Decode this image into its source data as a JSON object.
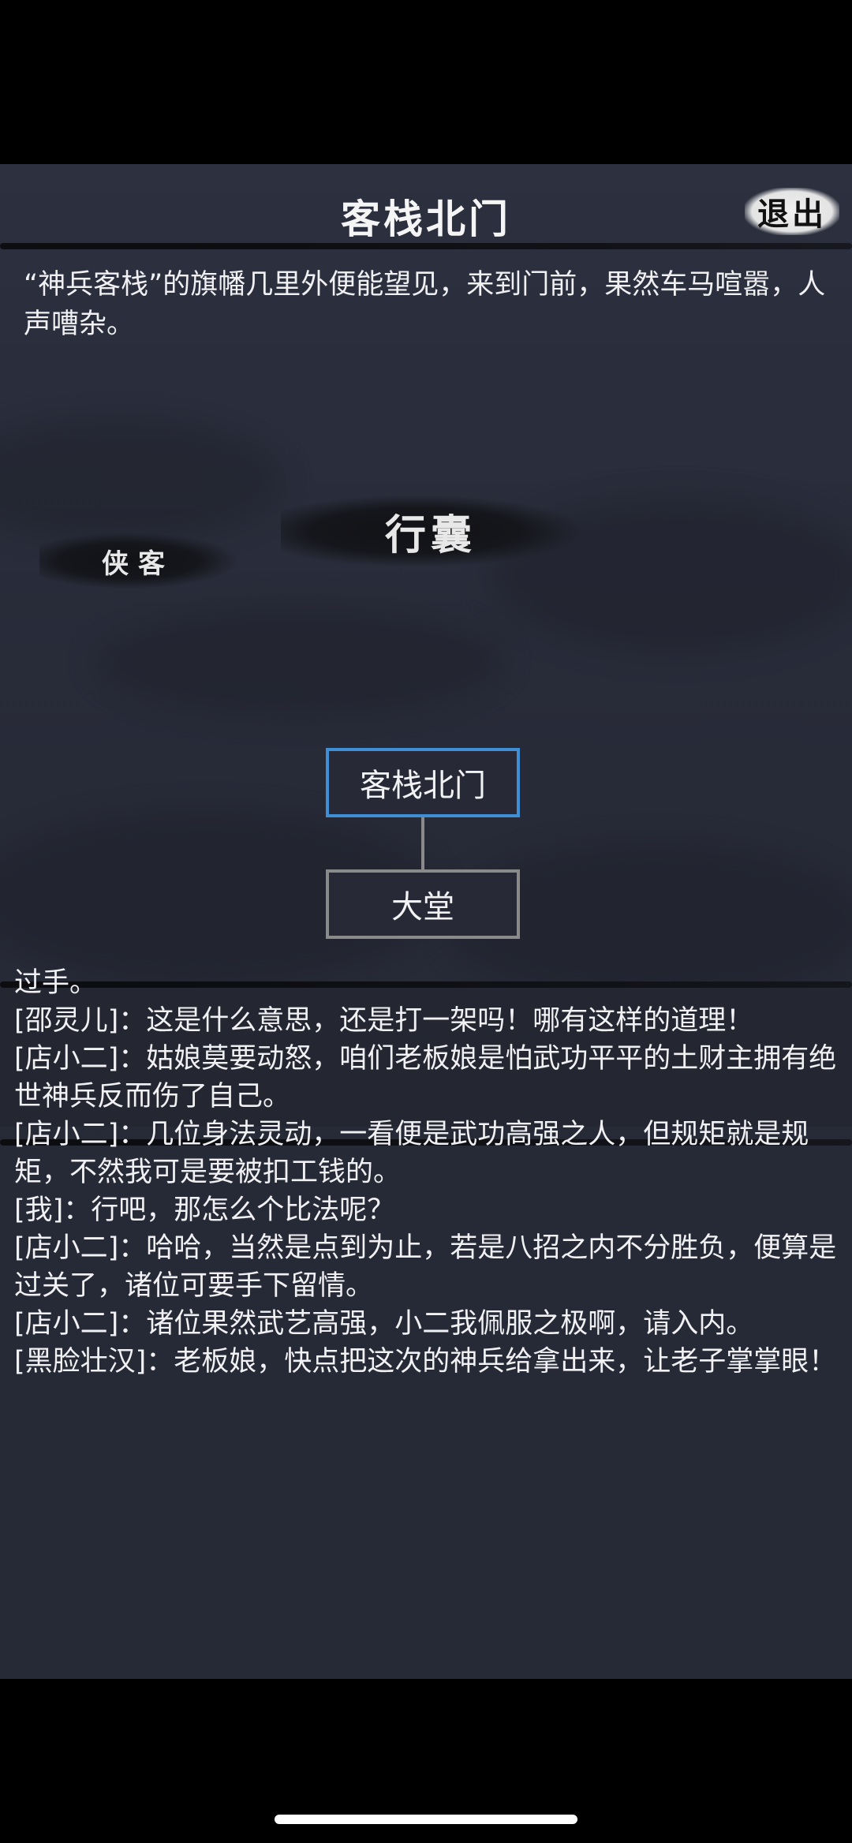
{
  "header": {
    "title": "客栈北门",
    "exit_label": "退出"
  },
  "description": "“神兵客栈”的旗幡几里外便能望见，来到门前，果然车马喧嚣，人声嘈杂。",
  "actions": {
    "bag_label": "行囊",
    "hero_label": "侠客"
  },
  "map": {
    "current_location": "客栈北门",
    "linked_location": "大堂",
    "current_border_color": "#3f8fd6",
    "linked_border_color": "#8a8a8a"
  },
  "log": [
    "过手。",
    "[邵灵儿]：这是什么意思，还是打一架吗！哪有这样的道理！",
    "[店小二]：姑娘莫要动怒，咱们老板娘是怕武功平平的土财主拥有绝世神兵反而伤了自己。",
    "[店小二]：几位身法灵动，一看便是武功高强之人，但规矩就是规矩，不然我可是要被扣工钱的。",
    "[我]：行吧，那怎么个比法呢？",
    "[店小二]：哈哈，当然是点到为止，若是八招之内不分胜负，便算是过关了，诸位可要手下留情。",
    "[店小二]：诸位果然武艺高强，小二我佩服之极啊，请入内。",
    "[黑脸壮汉]：老板娘，快点把这次的神兵给拿出来，让老子掌掌眼！"
  ]
}
